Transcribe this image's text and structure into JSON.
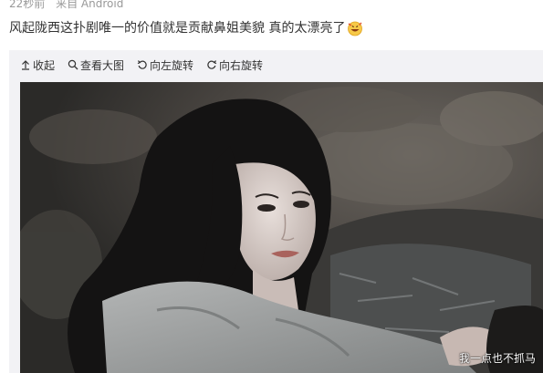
{
  "post": {
    "time": "22秒前",
    "source": "来自 Android",
    "text": "风起陇西这扑剧唯一的价值就是贡献鼻姐美貌 真的太漂亮了",
    "emoji_icon": "grinning-face-emoji"
  },
  "toolbar": {
    "collapse_label": "收起",
    "view_large_label": "查看大图",
    "rotate_left_label": "向左旋转",
    "rotate_right_label": "向右旋转"
  },
  "photo": {
    "watermark": "我一点也不抓马",
    "colors": {
      "background": "#3b3a38",
      "hair": "#141313",
      "coat": "#9a9c9c",
      "skin": "#d8cfcb"
    }
  }
}
